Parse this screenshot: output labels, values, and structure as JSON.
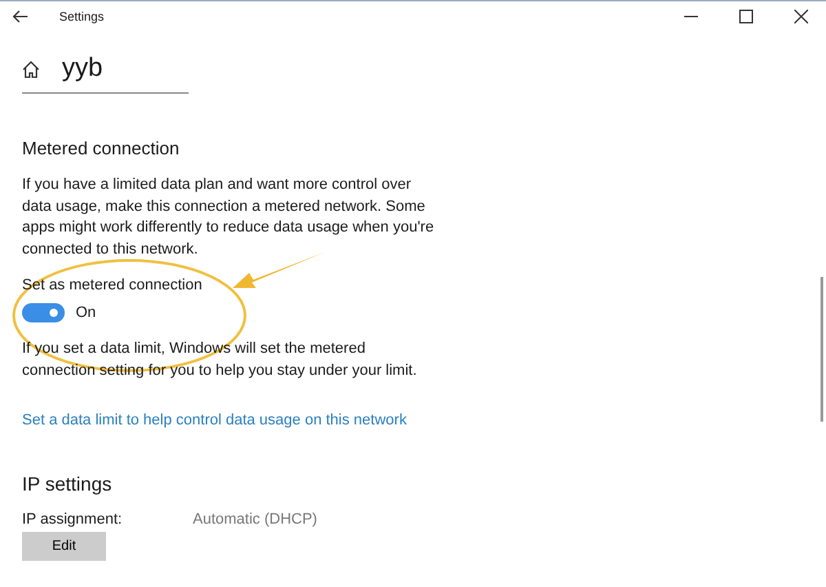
{
  "window": {
    "title": "Settings"
  },
  "header": {
    "title": "yyb"
  },
  "metered": {
    "heading": "Metered connection",
    "description": "If you have a limited data plan and want more control over data usage, make this connection a metered network. Some apps might work differently to reduce data usage when you're connected to this network.",
    "toggle": {
      "label": "Set as metered connection",
      "on": true,
      "state_text": "On"
    },
    "note": "If you set a data limit, Windows will set the metered connection setting for you to help you stay under your limit.",
    "link": "Set a data limit to help control data usage on this network"
  },
  "ip": {
    "heading": "IP settings",
    "label": "IP assignment:",
    "value": "Automatic (DHCP)",
    "button": "Edit"
  }
}
